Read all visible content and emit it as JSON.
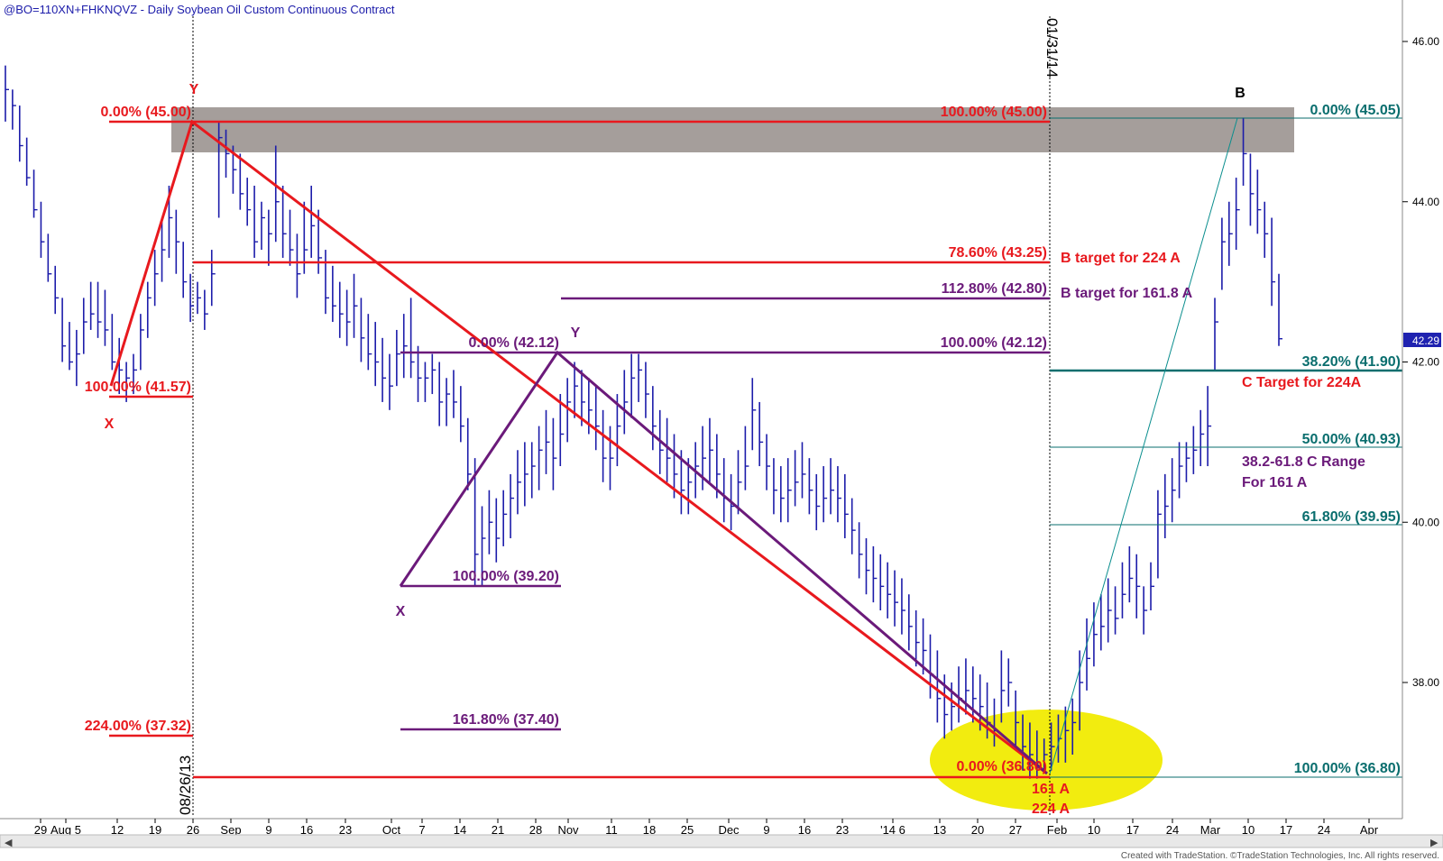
{
  "header": {
    "title": "@BO=110XN+FHKNQVZ - Daily  Soybean Oil Custom Continuous Contract"
  },
  "footer": {
    "credit": "Created with TradeStation. ©TradeStation Technologies, Inc. All rights reserved."
  },
  "colors": {
    "red": "#e8191e",
    "purple": "#6b1a7a",
    "teal": "#0a6e6e",
    "bars": "#1c1caa",
    "zone": "#a59e9b",
    "ellipse": "#f2ec0f",
    "price_box": "#1f22b0"
  },
  "chart_data": {
    "type": "bar",
    "title": "@BO=110XN+FHKNQVZ - Daily  Soybean Oil Custom Continuous Contract",
    "ylim": [
      35.0,
      47.0
    ],
    "y_ticks": [
      "46.00",
      "44.00",
      "42.00",
      "40.00",
      "38.00"
    ],
    "y_tick_values": [
      46,
      44,
      42,
      40,
      38
    ],
    "x_ticks": [
      "29",
      "Aug 5",
      "12",
      "19",
      "26",
      "Sep",
      "9",
      "16",
      "23",
      "Oct",
      "7",
      "14",
      "21",
      "28",
      "Nov",
      "11",
      "18",
      "25",
      "Dec",
      "9",
      "16",
      "23",
      "'14 6",
      "13",
      "20",
      "27",
      "Feb",
      "10",
      "17",
      "24",
      "Mar",
      "10",
      "17",
      "24",
      "Apr"
    ],
    "last_price": "42.29",
    "vertical_markers": [
      "08/26/13",
      "01/31/14"
    ],
    "resistance_zone": [
      44.6,
      45.2
    ],
    "pivots": [
      {
        "label": "X",
        "price": 41.57,
        "color": "red"
      },
      {
        "label": "Y",
        "price": 45.0,
        "color": "red"
      },
      {
        "label": "X",
        "price": 39.2,
        "color": "purple"
      },
      {
        "label": "Y",
        "price": 42.12,
        "color": "purple"
      },
      {
        "label": "B",
        "price": 45.05,
        "color": "black"
      }
    ],
    "points_labels": [
      "161 A",
      "224 A"
    ],
    "fib_levels": [
      {
        "text": "0.00% (45.00)",
        "price": 45.0,
        "color": "red"
      },
      {
        "text": "100.00% (41.57)",
        "price": 41.57,
        "color": "red"
      },
      {
        "text": "224.00% (37.32)",
        "price": 37.32,
        "color": "red"
      },
      {
        "text": "100.00% (45.00)",
        "price": 45.0,
        "color": "red"
      },
      {
        "text": "78.60% (43.25)",
        "price": 43.25,
        "color": "red"
      },
      {
        "text": "0.00% (36.80)",
        "price": 36.8,
        "color": "red"
      },
      {
        "text": "0.00% (42.12)",
        "price": 42.12,
        "color": "purple"
      },
      {
        "text": "100.00% (39.20)",
        "price": 39.2,
        "color": "purple"
      },
      {
        "text": "161.80% (37.40)",
        "price": 37.4,
        "color": "purple"
      },
      {
        "text": "112.80% (42.80)",
        "price": 42.8,
        "color": "purple"
      },
      {
        "text": "100.00% (42.12)",
        "price": 42.12,
        "color": "purple"
      },
      {
        "text": "0.00% (45.05)",
        "price": 45.05,
        "color": "teal"
      },
      {
        "text": "38.20% (41.90)",
        "price": 41.9,
        "color": "teal"
      },
      {
        "text": "50.00% (40.93)",
        "price": 40.93,
        "color": "teal"
      },
      {
        "text": "61.80% (39.95)",
        "price": 39.95,
        "color": "teal"
      },
      {
        "text": "100.00% (36.80)",
        "price": 36.8,
        "color": "teal"
      }
    ],
    "annotations": [
      {
        "text": "B target for 224 A",
        "color": "red"
      },
      {
        "text": "B target for 161.8 A",
        "color": "purple"
      },
      {
        "text": "C Target for 224A",
        "color": "red"
      },
      {
        "text": "38.2-61.8 C Range",
        "color": "purple"
      },
      {
        "text": "For 161 A",
        "color": "purple"
      }
    ],
    "ohlc_bars": [
      [
        45.7,
        45.0,
        45.4
      ],
      [
        45.4,
        44.9,
        45.2
      ],
      [
        45.2,
        44.5,
        44.7
      ],
      [
        44.8,
        44.2,
        44.3
      ],
      [
        44.4,
        43.8,
        43.9
      ],
      [
        44.0,
        43.3,
        43.5
      ],
      [
        43.6,
        43.0,
        43.1
      ],
      [
        43.2,
        42.6,
        42.8
      ],
      [
        42.8,
        42.0,
        42.2
      ],
      [
        42.5,
        41.9,
        42.0
      ],
      [
        42.4,
        41.7,
        42.1
      ],
      [
        42.8,
        42.1,
        42.5
      ],
      [
        43.0,
        42.4,
        42.6
      ],
      [
        43.0,
        42.3,
        42.5
      ],
      [
        42.9,
        42.2,
        42.4
      ],
      [
        42.6,
        41.9,
        42.0
      ],
      [
        42.3,
        41.6,
        41.9
      ],
      [
        42.0,
        41.5,
        41.8
      ],
      [
        42.1,
        41.6,
        41.9
      ],
      [
        42.6,
        41.9,
        42.4
      ],
      [
        43.0,
        42.3,
        42.8
      ],
      [
        43.4,
        42.7,
        43.1
      ],
      [
        43.8,
        43.0,
        43.4
      ],
      [
        44.2,
        43.3,
        43.8
      ],
      [
        43.9,
        43.1,
        43.5
      ],
      [
        43.5,
        42.8,
        43.0
      ],
      [
        43.1,
        42.5,
        42.7
      ],
      [
        43.0,
        42.6,
        42.8
      ],
      [
        42.9,
        42.4,
        42.6
      ],
      [
        43.4,
        42.7,
        43.1
      ],
      [
        45.0,
        43.8,
        44.8
      ],
      [
        44.9,
        44.3,
        44.6
      ],
      [
        44.7,
        44.1,
        44.4
      ],
      [
        44.6,
        43.9,
        44.1
      ],
      [
        44.3,
        43.7,
        43.9
      ],
      [
        44.2,
        43.3,
        43.5
      ],
      [
        44.0,
        43.4,
        43.8
      ],
      [
        43.9,
        43.2,
        43.6
      ],
      [
        44.7,
        43.5,
        44.0
      ],
      [
        44.2,
        43.3,
        43.6
      ],
      [
        43.9,
        43.2,
        43.4
      ],
      [
        43.6,
        42.8,
        43.1
      ],
      [
        44.0,
        43.1,
        43.4
      ],
      [
        44.2,
        43.3,
        43.7
      ],
      [
        43.9,
        43.1,
        43.3
      ],
      [
        43.4,
        42.6,
        42.8
      ],
      [
        43.2,
        42.5,
        42.7
      ],
      [
        43.0,
        42.3,
        42.6
      ],
      [
        42.9,
        42.2,
        42.5
      ],
      [
        43.1,
        42.3,
        42.7
      ],
      [
        42.8,
        42.0,
        42.3
      ],
      [
        42.6,
        41.9,
        42.1
      ],
      [
        42.5,
        41.7,
        42.0
      ],
      [
        42.3,
        41.5,
        41.8
      ],
      [
        42.1,
        41.4,
        41.7
      ],
      [
        42.4,
        41.7,
        42.1
      ],
      [
        42.6,
        41.8,
        42.2
      ],
      [
        42.8,
        41.8,
        42.0
      ],
      [
        42.2,
        41.5,
        41.8
      ],
      [
        42.0,
        41.5,
        41.8
      ],
      [
        42.1,
        41.6,
        41.9
      ],
      [
        42.0,
        41.2,
        41.5
      ],
      [
        41.8,
        41.2,
        41.6
      ],
      [
        41.9,
        41.3,
        41.5
      ],
      [
        41.7,
        41.0,
        41.2
      ],
      [
        41.3,
        40.4,
        40.6
      ],
      [
        40.8,
        39.2,
        39.6
      ],
      [
        40.2,
        39.2,
        39.8
      ],
      [
        40.4,
        39.6,
        40.0
      ],
      [
        40.3,
        39.5,
        39.8
      ],
      [
        40.4,
        39.7,
        40.1
      ],
      [
        40.6,
        39.8,
        40.3
      ],
      [
        40.9,
        40.1,
        40.5
      ],
      [
        41.0,
        40.2,
        40.6
      ],
      [
        41.0,
        40.3,
        40.7
      ],
      [
        41.2,
        40.4,
        40.9
      ],
      [
        41.4,
        40.6,
        41.0
      ],
      [
        41.3,
        40.4,
        40.8
      ],
      [
        41.6,
        40.7,
        41.1
      ],
      [
        41.8,
        41.0,
        41.5
      ],
      [
        42.0,
        41.3,
        41.7
      ],
      [
        41.9,
        41.2,
        41.5
      ],
      [
        41.8,
        41.1,
        41.4
      ],
      [
        41.7,
        40.9,
        41.2
      ],
      [
        41.4,
        40.5,
        40.8
      ],
      [
        41.2,
        40.4,
        40.8
      ],
      [
        41.6,
        40.7,
        41.2
      ],
      [
        41.9,
        41.1,
        41.5
      ],
      [
        42.1,
        41.3,
        41.8
      ],
      [
        42.1,
        41.5,
        41.9
      ],
      [
        42.0,
        41.3,
        41.6
      ],
      [
        41.7,
        40.9,
        41.2
      ],
      [
        41.4,
        40.6,
        40.9
      ],
      [
        41.3,
        40.5,
        40.8
      ],
      [
        41.1,
        40.3,
        40.6
      ],
      [
        40.9,
        40.1,
        40.4
      ],
      [
        40.8,
        40.1,
        40.5
      ],
      [
        41.0,
        40.3,
        40.7
      ],
      [
        41.2,
        40.4,
        40.8
      ],
      [
        41.3,
        40.5,
        40.9
      ],
      [
        41.1,
        40.3,
        40.6
      ],
      [
        40.8,
        40.0,
        40.3
      ],
      [
        40.6,
        39.9,
        40.2
      ],
      [
        40.9,
        40.1,
        40.5
      ],
      [
        41.2,
        40.4,
        40.7
      ],
      [
        41.8,
        40.9,
        41.4
      ],
      [
        41.5,
        40.7,
        41.0
      ],
      [
        41.1,
        40.4,
        40.7
      ],
      [
        40.8,
        40.1,
        40.4
      ],
      [
        40.7,
        40.0,
        40.3
      ],
      [
        40.8,
        40.0,
        40.4
      ],
      [
        40.9,
        40.2,
        40.5
      ],
      [
        41.0,
        40.3,
        40.6
      ],
      [
        40.8,
        40.1,
        40.4
      ],
      [
        40.6,
        39.9,
        40.2
      ],
      [
        40.7,
        40.0,
        40.3
      ],
      [
        40.8,
        40.1,
        40.4
      ],
      [
        40.7,
        40.0,
        40.3
      ],
      [
        40.6,
        39.8,
        40.1
      ],
      [
        40.3,
        39.6,
        39.9
      ],
      [
        40.0,
        39.3,
        39.6
      ],
      [
        39.8,
        39.1,
        39.4
      ],
      [
        39.7,
        39.0,
        39.3
      ],
      [
        39.6,
        38.9,
        39.2
      ],
      [
        39.5,
        38.8,
        39.1
      ],
      [
        39.4,
        38.7,
        39.0
      ],
      [
        39.3,
        38.6,
        38.9
      ],
      [
        39.1,
        38.4,
        38.7
      ],
      [
        38.9,
        38.2,
        38.5
      ],
      [
        38.8,
        38.1,
        38.4
      ],
      [
        38.6,
        37.8,
        38.1
      ],
      [
        38.4,
        37.5,
        37.8
      ],
      [
        38.1,
        37.3,
        37.6
      ],
      [
        38.0,
        37.4,
        37.7
      ],
      [
        38.2,
        37.5,
        37.8
      ],
      [
        38.3,
        37.6,
        37.9
      ],
      [
        38.2,
        37.5,
        37.8
      ],
      [
        38.1,
        37.4,
        37.7
      ],
      [
        38.0,
        37.3,
        37.5
      ],
      [
        37.8,
        37.2,
        37.4
      ],
      [
        38.4,
        37.5,
        37.9
      ],
      [
        38.3,
        37.7,
        38.0
      ],
      [
        37.9,
        37.2,
        37.5
      ],
      [
        37.6,
        36.9,
        37.2
      ],
      [
        37.5,
        36.8,
        37.1
      ],
      [
        37.4,
        36.8,
        37.0
      ],
      [
        37.3,
        36.9,
        37.1
      ],
      [
        37.5,
        36.9,
        37.2
      ],
      [
        37.6,
        37.0,
        37.3
      ],
      [
        37.7,
        37.0,
        37.4
      ],
      [
        37.8,
        37.1,
        37.5
      ],
      [
        38.4,
        37.4,
        38.0
      ],
      [
        38.8,
        37.9,
        38.3
      ],
      [
        39.0,
        38.2,
        38.6
      ],
      [
        39.1,
        38.4,
        38.7
      ],
      [
        39.3,
        38.5,
        38.9
      ],
      [
        39.2,
        38.6,
        38.8
      ],
      [
        39.5,
        38.8,
        39.1
      ],
      [
        39.7,
        39.0,
        39.3
      ],
      [
        39.6,
        38.8,
        39.2
      ],
      [
        39.2,
        38.6,
        38.9
      ],
      [
        39.5,
        38.9,
        39.2
      ],
      [
        40.4,
        39.3,
        40.1
      ],
      [
        40.6,
        39.8,
        40.2
      ],
      [
        40.8,
        40.0,
        40.4
      ],
      [
        41.0,
        40.3,
        40.7
      ],
      [
        41.0,
        40.5,
        40.8
      ],
      [
        41.2,
        40.6,
        40.9
      ],
      [
        41.4,
        40.7,
        41.1
      ],
      [
        41.7,
        40.7,
        41.2
      ],
      [
        42.8,
        41.9,
        42.5
      ],
      [
        43.8,
        42.9,
        43.5
      ],
      [
        44.0,
        43.2,
        43.6
      ],
      [
        44.3,
        43.4,
        43.9
      ],
      [
        45.05,
        44.2,
        44.6
      ],
      [
        44.6,
        43.7,
        44.1
      ],
      [
        44.4,
        43.6,
        43.9
      ],
      [
        44.0,
        43.3,
        43.6
      ],
      [
        43.8,
        42.7,
        43.0
      ],
      [
        43.1,
        42.2,
        42.29
      ]
    ]
  }
}
